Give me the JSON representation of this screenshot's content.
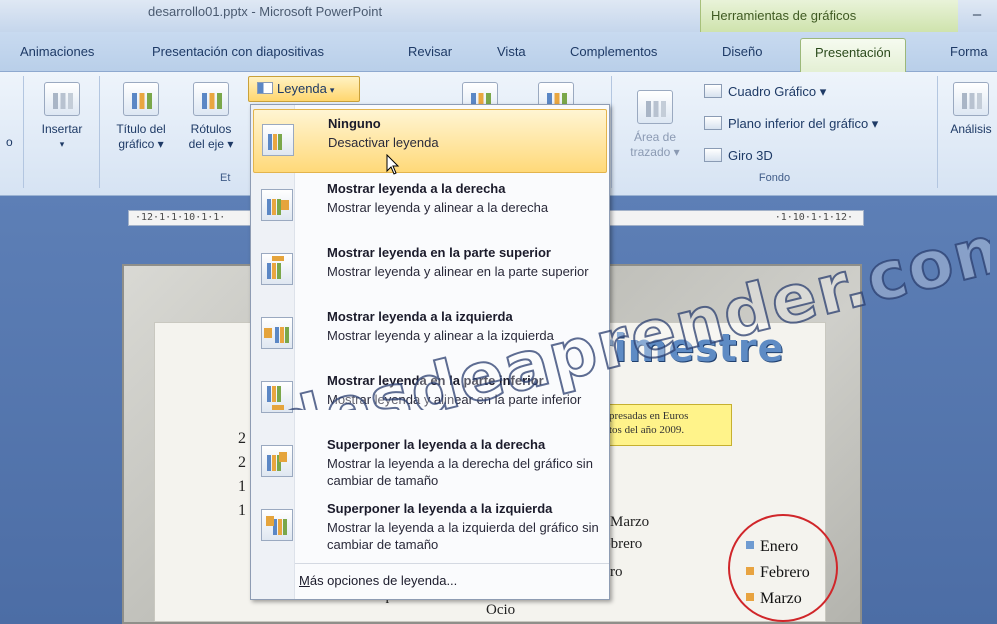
{
  "window": {
    "title": "desarrollo01.pptx - Microsoft PowerPoint",
    "context_group": "Herramientas de gráficos",
    "minimize": "–"
  },
  "tabs": [
    {
      "label": "Animaciones"
    },
    {
      "label": "Presentación con diapositivas"
    },
    {
      "label": "Revisar"
    },
    {
      "label": "Vista"
    },
    {
      "label": "Complementos"
    },
    {
      "label": "Diseño"
    },
    {
      "label": "Presentación"
    },
    {
      "label": "Forma"
    }
  ],
  "ribbon": {
    "insert": {
      "label": "Insertar"
    },
    "chart_title": {
      "label1": "Título del",
      "label2": "gráfico ▾"
    },
    "axis_titles": {
      "label1": "Rótulos",
      "label2": "del eje ▾"
    },
    "legend_button": {
      "label": "Leyenda"
    },
    "labels_group_fragment": "Et",
    "plot_area": {
      "label1": "Área de",
      "label2": "trazado ▾"
    },
    "chart_wall": {
      "label": "Cuadro Gráfico ▾"
    },
    "chart_floor": {
      "label": "Plano inferior del gráfico ▾"
    },
    "rotation_3d": {
      "label": "Giro 3D"
    },
    "background_group_fragment": "Fondo",
    "analysis_fragment": "Análisis",
    "left_fragment": "o"
  },
  "ruler": {
    "left": "·12·1·1·10·1·1·",
    "right": "·1·10·1·1·12·"
  },
  "slide": {
    "title_fragment": "rimestre",
    "note_line1": "presadas en Euros",
    "note_line2": "tos del año 2009.",
    "axis_numbers": [
      "2",
      "2",
      "1",
      "1"
    ],
    "categories": [
      "Marzo",
      "ebrero",
      "ro",
      "Ropa",
      "Ocio"
    ],
    "legend": [
      {
        "label": "Enero",
        "color": "#6f9bd1"
      },
      {
        "label": "Febrero",
        "color": "#e8a340"
      },
      {
        "label": "Marzo",
        "color": "#e8a340"
      }
    ]
  },
  "menu": {
    "items": [
      {
        "title": "Ninguno",
        "desc": "Desactivar leyenda"
      },
      {
        "title": "Mostrar leyenda a la derecha",
        "desc": "Mostrar leyenda y alinear a la derecha"
      },
      {
        "title": "Mostrar leyenda en la parte superior",
        "desc": "Mostrar leyenda y alinear en la parte superior"
      },
      {
        "title": "Mostrar leyenda a la izquierda",
        "desc": "Mostrar leyenda y alinear a la izquierda"
      },
      {
        "title": "Mostrar leyenda en la parte inferior",
        "desc": "Mostrar leyenda y alinear en la parte inferior"
      },
      {
        "title": "Superponer la leyenda a la derecha",
        "desc": "Mostrar la leyenda a la derecha del gráfico sin cambiar de tamaño"
      },
      {
        "title": "Superponer la leyenda a la izquierda",
        "desc": "Mostrar la leyenda a la izquierda del gráfico sin cambiar de tamaño"
      }
    ],
    "more_prefix": "M",
    "more_rest": "ás opciones de leyenda..."
  },
  "watermark": {
    "text": "www.desdeaprender.com"
  }
}
